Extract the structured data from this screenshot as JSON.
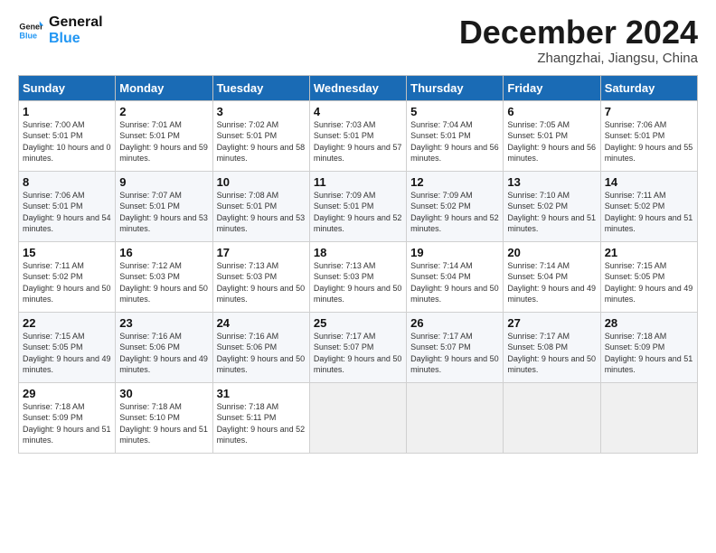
{
  "header": {
    "logo_line1": "General",
    "logo_line2": "Blue",
    "month": "December 2024",
    "location": "Zhangzhai, Jiangsu, China"
  },
  "days_of_week": [
    "Sunday",
    "Monday",
    "Tuesday",
    "Wednesday",
    "Thursday",
    "Friday",
    "Saturday"
  ],
  "weeks": [
    [
      {
        "day": "1",
        "sunrise": "Sunrise: 7:00 AM",
        "sunset": "Sunset: 5:01 PM",
        "daylight": "Daylight: 10 hours and 0 minutes."
      },
      {
        "day": "2",
        "sunrise": "Sunrise: 7:01 AM",
        "sunset": "Sunset: 5:01 PM",
        "daylight": "Daylight: 9 hours and 59 minutes."
      },
      {
        "day": "3",
        "sunrise": "Sunrise: 7:02 AM",
        "sunset": "Sunset: 5:01 PM",
        "daylight": "Daylight: 9 hours and 58 minutes."
      },
      {
        "day": "4",
        "sunrise": "Sunrise: 7:03 AM",
        "sunset": "Sunset: 5:01 PM",
        "daylight": "Daylight: 9 hours and 57 minutes."
      },
      {
        "day": "5",
        "sunrise": "Sunrise: 7:04 AM",
        "sunset": "Sunset: 5:01 PM",
        "daylight": "Daylight: 9 hours and 56 minutes."
      },
      {
        "day": "6",
        "sunrise": "Sunrise: 7:05 AM",
        "sunset": "Sunset: 5:01 PM",
        "daylight": "Daylight: 9 hours and 56 minutes."
      },
      {
        "day": "7",
        "sunrise": "Sunrise: 7:06 AM",
        "sunset": "Sunset: 5:01 PM",
        "daylight": "Daylight: 9 hours and 55 minutes."
      }
    ],
    [
      {
        "day": "8",
        "sunrise": "Sunrise: 7:06 AM",
        "sunset": "Sunset: 5:01 PM",
        "daylight": "Daylight: 9 hours and 54 minutes."
      },
      {
        "day": "9",
        "sunrise": "Sunrise: 7:07 AM",
        "sunset": "Sunset: 5:01 PM",
        "daylight": "Daylight: 9 hours and 53 minutes."
      },
      {
        "day": "10",
        "sunrise": "Sunrise: 7:08 AM",
        "sunset": "Sunset: 5:01 PM",
        "daylight": "Daylight: 9 hours and 53 minutes."
      },
      {
        "day": "11",
        "sunrise": "Sunrise: 7:09 AM",
        "sunset": "Sunset: 5:01 PM",
        "daylight": "Daylight: 9 hours and 52 minutes."
      },
      {
        "day": "12",
        "sunrise": "Sunrise: 7:09 AM",
        "sunset": "Sunset: 5:02 PM",
        "daylight": "Daylight: 9 hours and 52 minutes."
      },
      {
        "day": "13",
        "sunrise": "Sunrise: 7:10 AM",
        "sunset": "Sunset: 5:02 PM",
        "daylight": "Daylight: 9 hours and 51 minutes."
      },
      {
        "day": "14",
        "sunrise": "Sunrise: 7:11 AM",
        "sunset": "Sunset: 5:02 PM",
        "daylight": "Daylight: 9 hours and 51 minutes."
      }
    ],
    [
      {
        "day": "15",
        "sunrise": "Sunrise: 7:11 AM",
        "sunset": "Sunset: 5:02 PM",
        "daylight": "Daylight: 9 hours and 50 minutes."
      },
      {
        "day": "16",
        "sunrise": "Sunrise: 7:12 AM",
        "sunset": "Sunset: 5:03 PM",
        "daylight": "Daylight: 9 hours and 50 minutes."
      },
      {
        "day": "17",
        "sunrise": "Sunrise: 7:13 AM",
        "sunset": "Sunset: 5:03 PM",
        "daylight": "Daylight: 9 hours and 50 minutes."
      },
      {
        "day": "18",
        "sunrise": "Sunrise: 7:13 AM",
        "sunset": "Sunset: 5:03 PM",
        "daylight": "Daylight: 9 hours and 50 minutes."
      },
      {
        "day": "19",
        "sunrise": "Sunrise: 7:14 AM",
        "sunset": "Sunset: 5:04 PM",
        "daylight": "Daylight: 9 hours and 50 minutes."
      },
      {
        "day": "20",
        "sunrise": "Sunrise: 7:14 AM",
        "sunset": "Sunset: 5:04 PM",
        "daylight": "Daylight: 9 hours and 49 minutes."
      },
      {
        "day": "21",
        "sunrise": "Sunrise: 7:15 AM",
        "sunset": "Sunset: 5:05 PM",
        "daylight": "Daylight: 9 hours and 49 minutes."
      }
    ],
    [
      {
        "day": "22",
        "sunrise": "Sunrise: 7:15 AM",
        "sunset": "Sunset: 5:05 PM",
        "daylight": "Daylight: 9 hours and 49 minutes."
      },
      {
        "day": "23",
        "sunrise": "Sunrise: 7:16 AM",
        "sunset": "Sunset: 5:06 PM",
        "daylight": "Daylight: 9 hours and 49 minutes."
      },
      {
        "day": "24",
        "sunrise": "Sunrise: 7:16 AM",
        "sunset": "Sunset: 5:06 PM",
        "daylight": "Daylight: 9 hours and 50 minutes."
      },
      {
        "day": "25",
        "sunrise": "Sunrise: 7:17 AM",
        "sunset": "Sunset: 5:07 PM",
        "daylight": "Daylight: 9 hours and 50 minutes."
      },
      {
        "day": "26",
        "sunrise": "Sunrise: 7:17 AM",
        "sunset": "Sunset: 5:07 PM",
        "daylight": "Daylight: 9 hours and 50 minutes."
      },
      {
        "day": "27",
        "sunrise": "Sunrise: 7:17 AM",
        "sunset": "Sunset: 5:08 PM",
        "daylight": "Daylight: 9 hours and 50 minutes."
      },
      {
        "day": "28",
        "sunrise": "Sunrise: 7:18 AM",
        "sunset": "Sunset: 5:09 PM",
        "daylight": "Daylight: 9 hours and 51 minutes."
      }
    ],
    [
      {
        "day": "29",
        "sunrise": "Sunrise: 7:18 AM",
        "sunset": "Sunset: 5:09 PM",
        "daylight": "Daylight: 9 hours and 51 minutes."
      },
      {
        "day": "30",
        "sunrise": "Sunrise: 7:18 AM",
        "sunset": "Sunset: 5:10 PM",
        "daylight": "Daylight: 9 hours and 51 minutes."
      },
      {
        "day": "31",
        "sunrise": "Sunrise: 7:18 AM",
        "sunset": "Sunset: 5:11 PM",
        "daylight": "Daylight: 9 hours and 52 minutes."
      },
      null,
      null,
      null,
      null
    ]
  ]
}
